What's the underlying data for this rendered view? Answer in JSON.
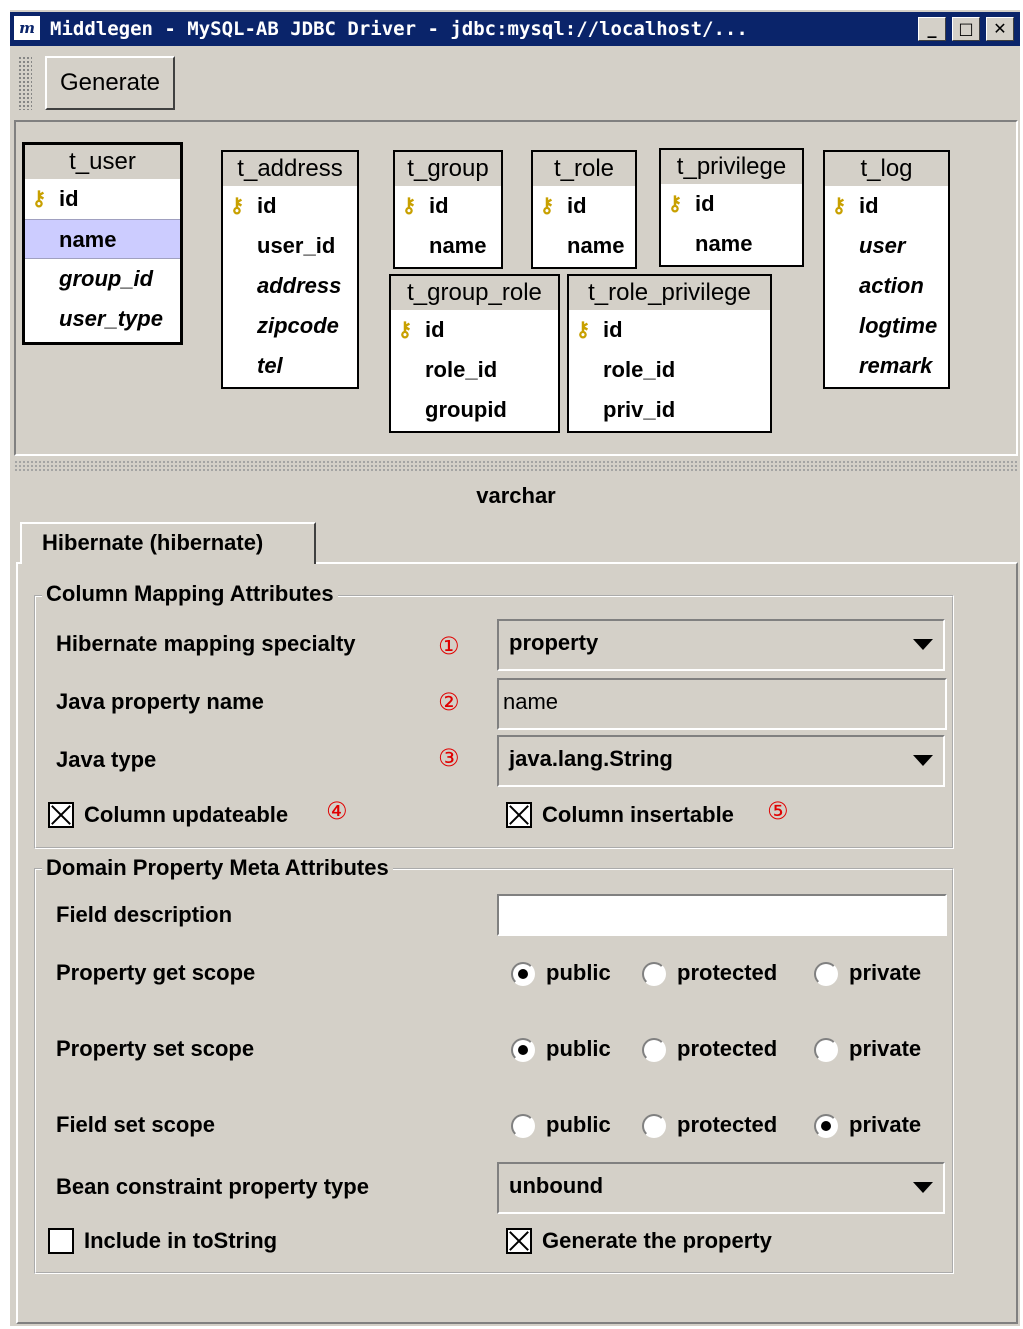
{
  "window": {
    "title": "Middlegen - MySQL-AB JDBC Driver - jdbc:mysql://localhost/...",
    "app_icon": "m",
    "controls": {
      "minimize": "_",
      "maximize": "□",
      "close": "✕"
    }
  },
  "toolbar": {
    "generate_label": "Generate"
  },
  "tables": [
    {
      "name": "t_user",
      "columns": [
        "id",
        "name",
        "group_id",
        "user_type"
      ]
    },
    {
      "name": "t_address",
      "columns": [
        "id",
        "user_id",
        "address",
        "zipcode",
        "tel"
      ]
    },
    {
      "name": "t_group",
      "columns": [
        "id",
        "name"
      ]
    },
    {
      "name": "t_role",
      "columns": [
        "id",
        "name"
      ]
    },
    {
      "name": "t_privilege",
      "columns": [
        "id",
        "name"
      ]
    },
    {
      "name": "t_log",
      "columns": [
        "id",
        "user",
        "action",
        "logtime",
        "remark"
      ]
    },
    {
      "name": "t_group_role",
      "columns": [
        "id",
        "role_id",
        "groupid"
      ]
    },
    {
      "name": "t_role_privilege",
      "columns": [
        "id",
        "role_id",
        "priv_id"
      ]
    }
  ],
  "selected_column_type": "varchar",
  "tab": {
    "label": "Hibernate (hibernate)"
  },
  "column_mapping": {
    "legend": "Column Mapping Attributes",
    "specialty_label": "Hibernate mapping specialty",
    "specialty_value": "property",
    "property_name_label": "Java property name",
    "property_name_value": "name",
    "java_type_label": "Java type",
    "java_type_value": "java.lang.String",
    "updateable_label": "Column updateable",
    "updateable_checked": true,
    "insertable_label": "Column insertable",
    "insertable_checked": true,
    "markers": [
      "①",
      "②",
      "③",
      "④",
      "⑤"
    ]
  },
  "domain_meta": {
    "legend": "Domain Property Meta Attributes",
    "field_description_label": "Field description",
    "field_description_value": "",
    "get_scope_label": "Property get scope",
    "set_scope_label": "Property set scope",
    "field_set_scope_label": "Field set scope",
    "scope_options": [
      "public",
      "protected",
      "private"
    ],
    "get_scope_selected": "public",
    "set_scope_selected": "public",
    "field_set_scope_selected": "private",
    "bean_constraint_label": "Bean constraint property type",
    "bean_constraint_value": "unbound",
    "include_tostring_label": "Include in toString",
    "include_tostring_checked": false,
    "generate_property_label": "Generate the property",
    "generate_property_checked": true
  }
}
